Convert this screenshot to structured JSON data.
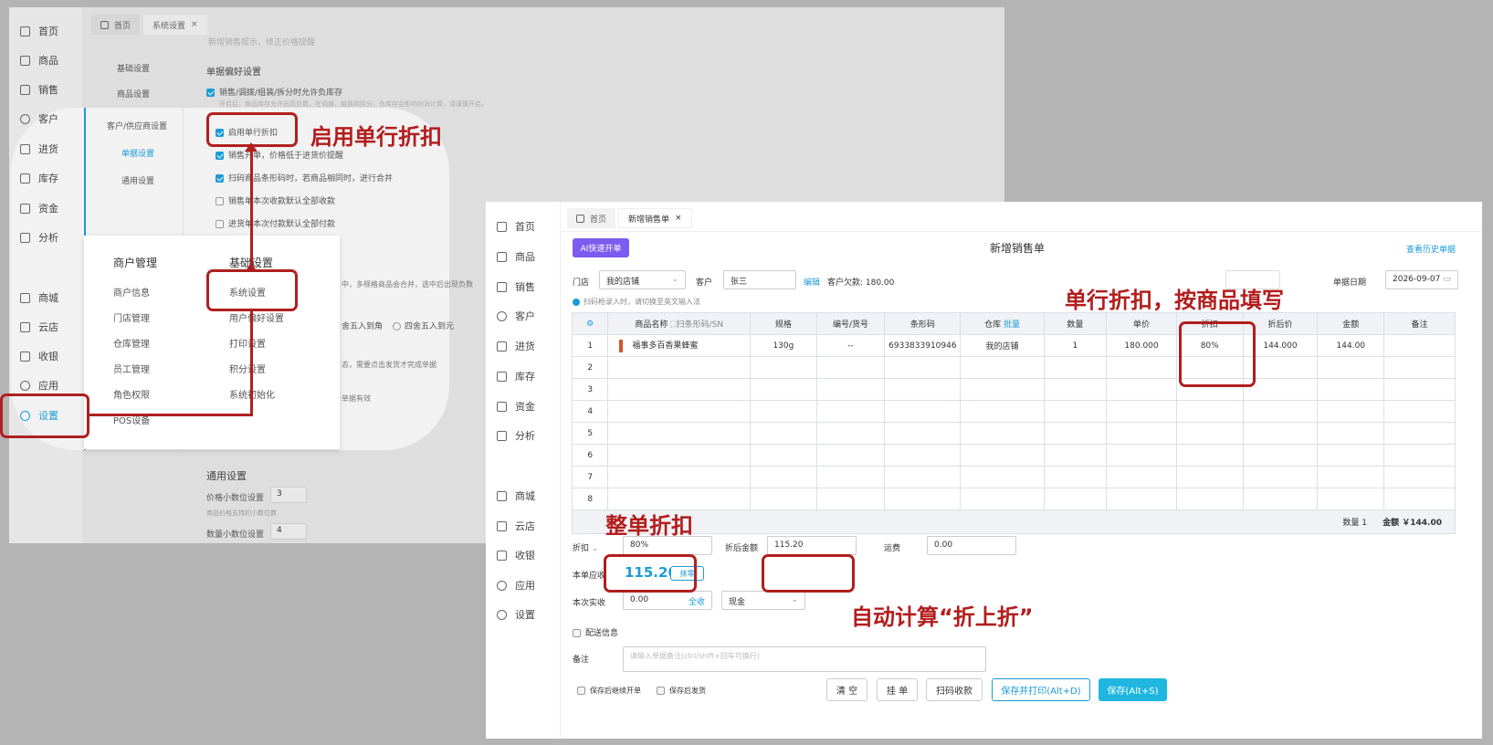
{
  "nav": [
    "首页",
    "商品",
    "销售",
    "客户",
    "进货",
    "库存",
    "资金",
    "分析",
    "商城",
    "云店",
    "收银",
    "应用",
    "设置"
  ],
  "back": {
    "tabs": [
      "首页",
      "系统设置"
    ],
    "top_cut": "新增销售提示，修正价格提醒",
    "sub_items": [
      "基础设置",
      "商品设置",
      "客户/供应商设置",
      "单据设置",
      "通用设置"
    ],
    "section": "单据偏好设置",
    "opts": [
      "销售/调拨/组装/拆分时允许负库存",
      "启用单行折扣",
      "销售开单，价格低于进货价提醒",
      "扫码商品条形码时，若商品相同时，进行合并",
      "销售单本次收款默认全部收款",
      "进货单本次付款默认全部付款"
    ],
    "opt_hint": "开启后，商品库存允许出现负数，在调拨、组装和拆分，负库存会影响利润计算，请谨慎开启。",
    "general": "通用设置",
    "price_dec": "价格小数位设置",
    "price_dec_v": "3",
    "price_hint": "商品价格支持的小数位数",
    "qty_dec": "数量小数位设置",
    "qty_dec_v": "4",
    "frag1": "中，多规格商品会合并，选中后出现负数",
    "round1": "舍五入到角",
    "round2": "四舍五入到元",
    "frag2": "态，需要点击发货才完成单据",
    "frag3": "单据有效",
    "menu": {
      "h1": "商户管理",
      "h2": "基础设置",
      "col1": [
        "商户信息",
        "门店管理",
        "仓库管理",
        "员工管理",
        "角色权限",
        "POS设备"
      ],
      "col2": [
        "系统设置",
        "用户偏好设置",
        "打印设置",
        "积分设置",
        "系统初始化"
      ]
    }
  },
  "front": {
    "tabs": [
      "首页",
      "新增销售单"
    ],
    "ai_btn": "AI快速开单",
    "title": "新增销售单",
    "history": "查看历史单据",
    "store_label": "门店",
    "store": "我的店铺",
    "cust_label": "客户",
    "cust": "张三",
    "edit": "编辑",
    "owe": "客户欠款: 180.00",
    "date_label": "单据日期",
    "date": "2026-09-07",
    "scan_tip": "扫码枪录入时，请切换至英文输入法",
    "headers": [
      "商品名称",
      "规格",
      "编号/货号",
      "条形码",
      "仓库",
      "数量",
      "单价",
      "折扣",
      "折后价",
      "金额",
      "备注"
    ],
    "barcode_hdr": "扫条形码/SN",
    "batch": "批量",
    "row": {
      "name": "福事多百香果蜂蜜",
      "spec": "130g",
      "code": "--",
      "barcode": "6933833910946",
      "wh": "我的店铺",
      "qty": "1",
      "price": "180.000",
      "disc": "80%",
      "dprice": "144.000",
      "amt": "144.00"
    },
    "summary_qty": "数量 1",
    "summary_amt": "金额 ￥144.00",
    "disc_label": "折扣",
    "disc_val": "80%",
    "after_label": "折后金额",
    "after_val": "115.20",
    "freight_label": "运费",
    "freight_val": "0.00",
    "due_label": "本单应收",
    "due_val": "115.20",
    "round_btn": "抹零",
    "paid_label": "本次实收",
    "paid_val": "0.00",
    "all": "全收",
    "pay": "现金",
    "delivery": "配送信息",
    "note_label": "备注",
    "note_ph": "请输入单据备注(ctrl/shift+回车可换行)",
    "cont": "保存后继续开单",
    "ship": "保存后发货",
    "btns": [
      "清 空",
      "挂 单",
      "扫码收款",
      "保存并打印(Alt+D)",
      "保存(Alt+S)"
    ]
  },
  "ann": {
    "a1": "启用单行折扣",
    "a2": "单行折扣，按商品填写",
    "a3": "整单折扣",
    "a4": "自动计算“折上折”"
  },
  "colors": {
    "accent": "#1b9bd6",
    "annotation": "#b01f1f",
    "ai": "#7b5cf0"
  }
}
